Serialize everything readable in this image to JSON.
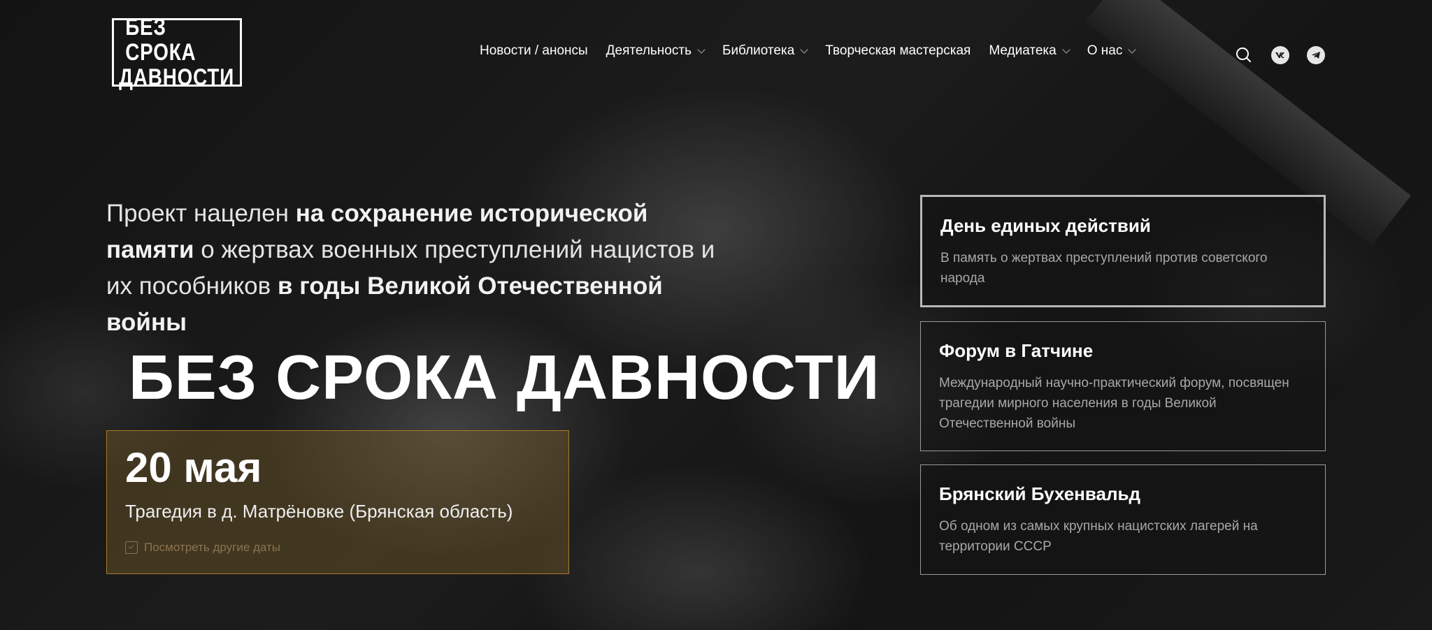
{
  "logo": {
    "line1": "БЕЗ СРОКА",
    "line2": "ДАВНОСТИ"
  },
  "nav": {
    "items": [
      {
        "label": "Новости / анонсы",
        "has_dropdown": false
      },
      {
        "label": "Деятельность",
        "has_dropdown": true
      },
      {
        "label": "Библиотека",
        "has_dropdown": true
      },
      {
        "label": "Творческая мастерская",
        "has_dropdown": false
      },
      {
        "label": "Медиатека",
        "has_dropdown": true
      },
      {
        "label": "О нас",
        "has_dropdown": true
      }
    ]
  },
  "header_icons": {
    "search": "search-icon",
    "vk": "vk-icon",
    "telegram": "telegram-icon"
  },
  "intro": {
    "p1": "Проект нацелен ",
    "b1": "на сохранение исторической памяти",
    "p2": " о жертвах военных преступлений нацистов и их пособников ",
    "b2": "в годы Великой Отечественной войны"
  },
  "big_title": "БЕЗ СРОКА ДАВНОСТИ",
  "date_card": {
    "date": "20 мая",
    "event": "Трагедия в д. Матрёновке (Брянская область)",
    "link": "Посмотреть другие даты"
  },
  "cards": [
    {
      "title": "День единых действий",
      "text": "В память о жертвах преступлений против советского народа"
    },
    {
      "title": "Форум в Гатчине",
      "text": "Международный научно-практический форум, посвящен трагедии мирного населения в годы Великой Отечественной войны"
    },
    {
      "title": "Брянский Бухенвальд",
      "text": "Об одном из самых крупных нацистских лагерей на территории СССР"
    }
  ],
  "colors": {
    "accent": "#a87a2a",
    "card_border": "#9a9a9a",
    "text_muted": "#a8a8a8"
  }
}
